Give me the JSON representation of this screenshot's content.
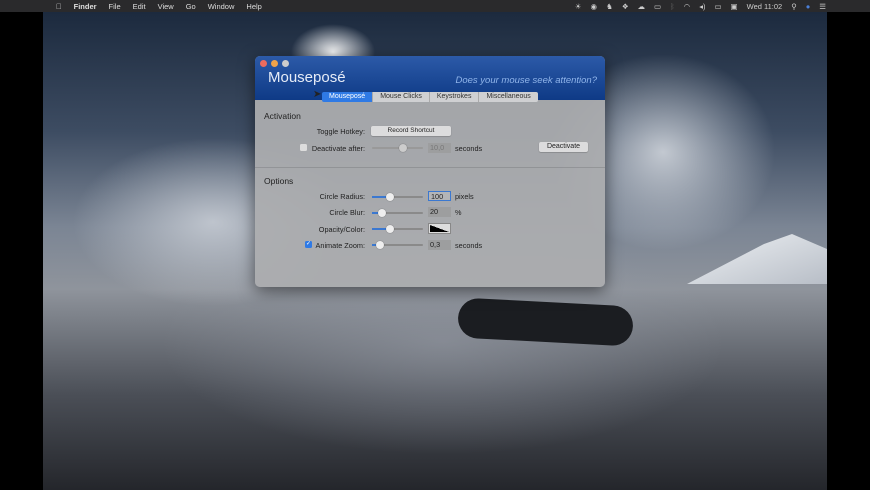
{
  "menubar": {
    "apple": "",
    "items": [
      "Finder",
      "File",
      "Edit",
      "View",
      "Go",
      "Window",
      "Help"
    ],
    "clock": "Wed 11:02",
    "tray_icons": [
      "brightness-icon",
      "eye-icon",
      "paw-icon",
      "dropbox-icon",
      "cloud-icon",
      "airplay-icon",
      "bluetooth-icon",
      "wifi-icon",
      "volume-icon",
      "battery-icon",
      "display-icon"
    ]
  },
  "window": {
    "title": "Mouseposé",
    "tagline": "Does your mouse seek attention?",
    "tabs": [
      "Mouseposé",
      "Mouse Clicks",
      "Keystrokes",
      "Miscellaneous"
    ],
    "active_tab": 0,
    "activation": {
      "heading": "Activation",
      "toggle_hotkey_label": "Toggle Hotkey:",
      "record_button": "Record Shortcut",
      "deactivate_after_label": "Deactivate after:",
      "deactivate_after_checked": false,
      "deactivate_after_value": "10,0",
      "deactivate_after_unit": "seconds",
      "deactivate_button": "Deactivate",
      "deactivate_slider": 0.6
    },
    "options": {
      "heading": "Options",
      "circle_radius": {
        "label": "Circle Radius:",
        "value": "100",
        "unit": "pixels",
        "slider": 0.35
      },
      "circle_blur": {
        "label": "Circle Blur:",
        "value": "20",
        "unit": "%",
        "slider": 0.2
      },
      "opacity_color": {
        "label": "Opacity/Color:",
        "slider": 0.35,
        "color": "#000000"
      },
      "animate_zoom": {
        "label": "Animate Zoom:",
        "checked": true,
        "value": "0,3",
        "unit": "seconds",
        "slider": 0.15
      }
    }
  },
  "colors": {
    "accent": "#2f7ae5",
    "header": "#0e3a86"
  }
}
